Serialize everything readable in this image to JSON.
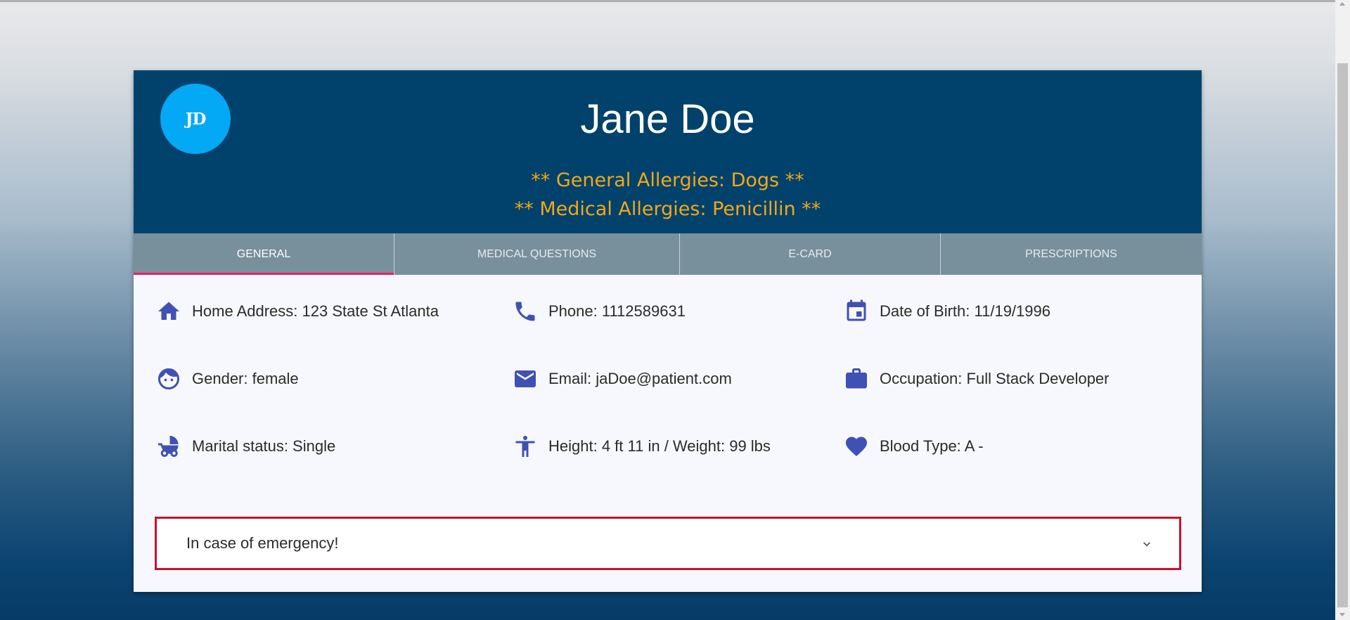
{
  "patient": {
    "initials": "JD",
    "name": "Jane Doe",
    "general_allergies": "** General Allergies: Dogs **",
    "medical_allergies": "** Medical Allergies: Penicillin **"
  },
  "tabs": [
    {
      "label": "GENERAL",
      "active": true
    },
    {
      "label": "MEDICAL QUESTIONS",
      "active": false
    },
    {
      "label": "E-CARD",
      "active": false
    },
    {
      "label": "PRESCRIPTIONS",
      "active": false
    }
  ],
  "info": {
    "home_address": {
      "icon": "home-icon",
      "text": "Home Address: 123 State St Atlanta"
    },
    "phone": {
      "icon": "phone-icon",
      "text": "Phone: 1112589631"
    },
    "dob": {
      "icon": "calendar-icon",
      "text": "Date of Birth: 11/19/1996"
    },
    "gender": {
      "icon": "face-icon",
      "text": "Gender: female"
    },
    "email": {
      "icon": "mail-icon",
      "text": "Email: jaDoe@patient.com"
    },
    "occupation": {
      "icon": "briefcase-icon",
      "text": "Occupation: Full Stack Developer"
    },
    "marital": {
      "icon": "stroller-icon",
      "text": "Marital status: Single"
    },
    "height_weight": {
      "icon": "accessibility-icon",
      "text": "Height: 4 ft 11 in / Weight: 99 lbs"
    },
    "blood_type": {
      "icon": "heart-icon",
      "text": "Blood Type: A -"
    }
  },
  "emergency": {
    "label": "In case of emergency!",
    "icon": "chevron-down-icon"
  },
  "colors": {
    "header_bg": "#00426b",
    "avatar_bg": "#03a9f4",
    "allergy_text": "#f2a71b",
    "tab_bg": "#78909c",
    "tab_indicator": "#e91e63",
    "icon": "#3f51b5",
    "emergency_border": "#c8102e"
  }
}
